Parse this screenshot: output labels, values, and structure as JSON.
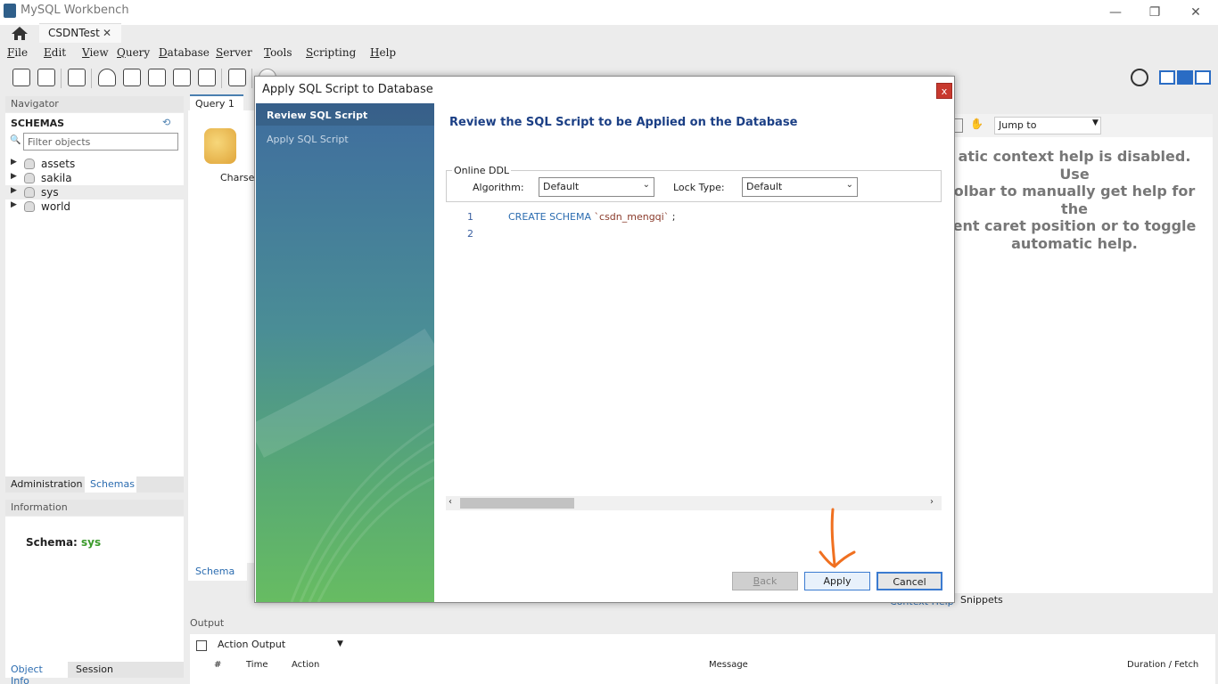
{
  "window": {
    "title": "MySQL Workbench",
    "minimize_glyph": "—",
    "restore_glyph": "❐",
    "close_glyph": "✕"
  },
  "tabs": {
    "connection_tab": "CSDNTest",
    "close_glyph": "✕"
  },
  "menu": [
    {
      "mnemonic": "F",
      "rest": "ile"
    },
    {
      "mnemonic": "E",
      "rest": "dit"
    },
    {
      "mnemonic": "V",
      "rest": "iew"
    },
    {
      "mnemonic": "Q",
      "rest": "uery"
    },
    {
      "mnemonic": "D",
      "rest": "atabase"
    },
    {
      "mnemonic": "S",
      "rest": "erver"
    },
    {
      "mnemonic": "T",
      "rest": "ools"
    },
    {
      "mnemonic": "S",
      "rest": "cripting"
    },
    {
      "mnemonic": "H",
      "rest": "elp"
    }
  ],
  "toolbar_icons": [
    "new-sql-tab-icon",
    "open-sql-script-icon",
    "inspector-icon",
    "create-schema-icon",
    "create-table-icon",
    "create-view-icon",
    "create-procedure-icon",
    "create-function-icon",
    "search-table-data-icon",
    "reconnect-icon",
    "settings-icon",
    "layout-toggle-icon"
  ],
  "navigator": {
    "header": "Navigator",
    "schemas_title": "SCHEMAS",
    "filter_placeholder": "Filter objects",
    "schemas": [
      "assets",
      "sakila",
      "sys",
      "world"
    ],
    "selected_schema": "sys",
    "tabs": [
      "Administration",
      "Schemas"
    ],
    "active_tab": "Schemas"
  },
  "information": {
    "header": "Information",
    "schema_label": "Schema:",
    "schema_value": "sys",
    "tabs": [
      "Object Info",
      "Session"
    ]
  },
  "editor": {
    "query_tab": "Query 1",
    "charset_label": "Charset",
    "schema_tab": "Schema"
  },
  "right_panel": {
    "jump_to": "Jump to",
    "context_help": [
      "atic context help is disabled. Use",
      "olbar to manually get help for the",
      "ent caret position or to toggle",
      "automatic help."
    ],
    "tabs": [
      "Context Help",
      "Snippets"
    ]
  },
  "output": {
    "header": "Output",
    "selector": "Action Output",
    "columns": [
      "#",
      "Time",
      "Action",
      "Message",
      "Duration / Fetch"
    ]
  },
  "dialog": {
    "title": "Apply SQL Script to Database",
    "close_glyph": "x",
    "steps": [
      "Review SQL Script",
      "Apply SQL Script"
    ],
    "active_step": "Review SQL Script",
    "heading": "Review the SQL Script to be Applied on the Database",
    "online_ddl": {
      "legend": "Online DDL",
      "algorithm_label": "Algorithm:",
      "algorithm_value": "Default",
      "lock_label": "Lock Type:",
      "lock_value": "Default"
    },
    "script": {
      "line_numbers": [
        "1",
        "2"
      ],
      "keyword": "CREATE SCHEMA ",
      "schema_name": "`csdn_mengqi`",
      "terminator": " ;"
    },
    "buttons": {
      "back_mnemonic": "B",
      "back_rest": "ack",
      "apply": "Apply",
      "cancel": "Cancel"
    },
    "accent_color": "#3b7bd0"
  },
  "annotation": {
    "arrow_color": "#f07020"
  }
}
